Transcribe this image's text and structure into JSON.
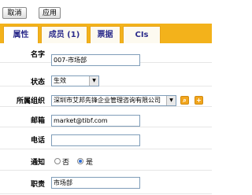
{
  "toolbar": {
    "cancel_label": "取消",
    "apply_label": "应用"
  },
  "tabs": [
    {
      "label": "属性"
    },
    {
      "label": "成员 (1)"
    },
    {
      "label": "票据"
    },
    {
      "label": "CIs"
    }
  ],
  "form": {
    "name_label": "名字",
    "name_value": "007-市场部",
    "status_label": "状态",
    "status_value": "生效",
    "org_label": "所属组织",
    "org_value": "深圳市艾邦先锋企业管理咨询有限公司",
    "email_label": "邮箱",
    "email_value": "market@tibf.com",
    "phone_label": "电话",
    "phone_value": "",
    "notify_label": "通知",
    "notify_options": [
      "否",
      "是"
    ],
    "notify_selected": "是",
    "title_label": "职责",
    "title_value": "市场部"
  },
  "colors": {
    "tab_bar": "#f3b21b",
    "tab_text": "#2d2d8c",
    "icon_button": "#f2a61e"
  }
}
